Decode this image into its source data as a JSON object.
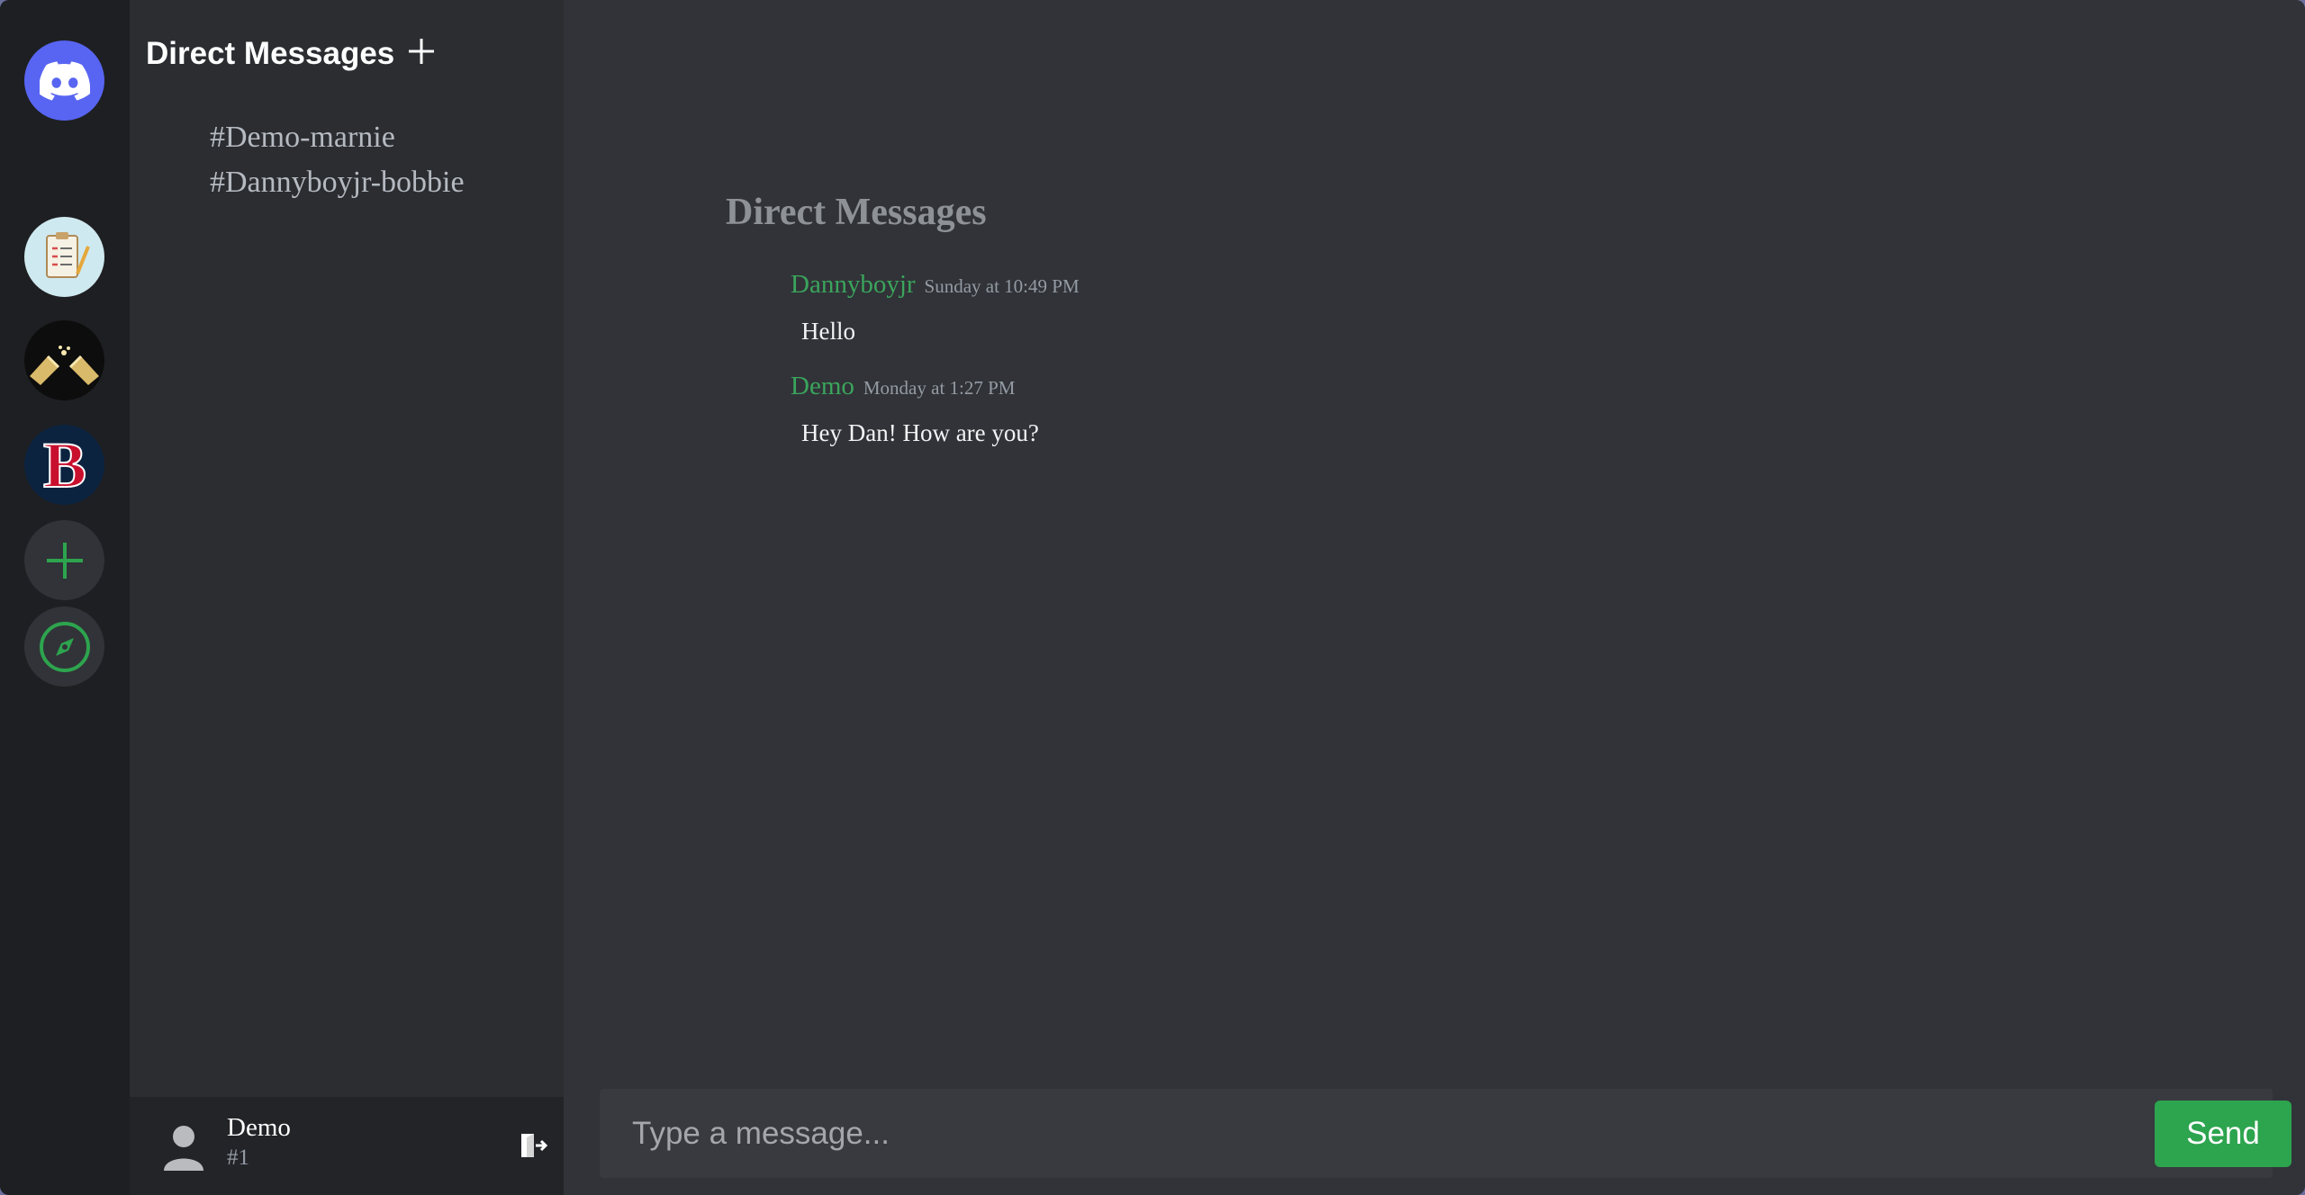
{
  "sidebar": {
    "title": "Direct Messages",
    "add_icon": "plus-icon",
    "dms": [
      {
        "label": "#Demo-marnie"
      },
      {
        "label": "#Dannyboyjr-bobbie"
      }
    ]
  },
  "servers": [
    {
      "name": "home",
      "icon": "discord-logo-icon"
    },
    {
      "name": "server-1",
      "icon": "clipboard-icon"
    },
    {
      "name": "server-2",
      "icon": "champagne-icon"
    },
    {
      "name": "server-3",
      "icon": "red-sox-logo-icon"
    },
    {
      "name": "add-server",
      "icon": "plus-icon"
    },
    {
      "name": "explore",
      "icon": "compass-icon"
    }
  ],
  "user": {
    "name": "Demo",
    "tag": "#1"
  },
  "main": {
    "title": "Direct Messages",
    "messages": [
      {
        "author": "Dannyboyjr",
        "timestamp": "Sunday at 10:49 PM",
        "text": "Hello"
      },
      {
        "author": "Demo",
        "timestamp": "Monday at 1:27 PM",
        "text": "Hey Dan! How are you?"
      }
    ]
  },
  "composer": {
    "placeholder": "Type a message...",
    "send_label": "Send"
  },
  "colors": {
    "accent": "#5865f2",
    "author": "#3ba55c",
    "send": "#2da44e"
  }
}
